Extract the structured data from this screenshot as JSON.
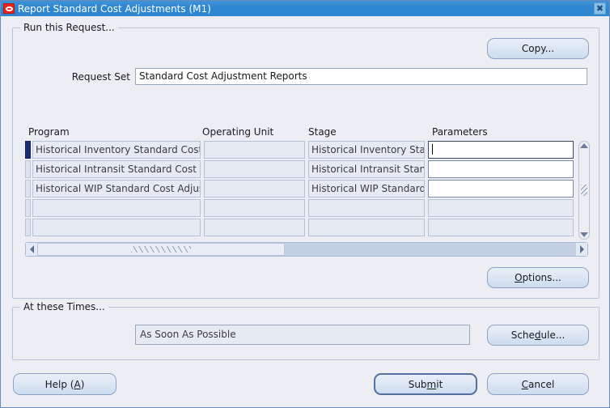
{
  "window": {
    "title": "Report Standard Cost Adjustments (M1)",
    "logo_icon": "oracle-logo-icon",
    "close_icon": "close-icon",
    "title_bar_color": "#2f86d0",
    "background_color": "#eceef4"
  },
  "run_request": {
    "legend": "Run this Request...",
    "copy_label": "Copy...",
    "options_label": "Options...",
    "request_set": {
      "label": "Request Set",
      "value": "Standard Cost Adjustment Reports",
      "placeholder": ""
    },
    "table": {
      "columns": [
        "Program",
        "Operating Unit",
        "Stage",
        "Parameters"
      ],
      "rows": [
        {
          "selected": true,
          "program": "Historical Inventory Standard Cost A",
          "operating_unit": "",
          "stage": "Historical Inventory Stand",
          "parameters": "",
          "parameters_editable": true,
          "parameters_focused": true
        },
        {
          "selected": false,
          "program": "Historical Intransit Standard Cost A",
          "operating_unit": "",
          "stage": "Historical Intransit Standa",
          "parameters": "",
          "parameters_editable": true,
          "parameters_focused": false
        },
        {
          "selected": false,
          "program": "Historical WIP Standard Cost Adjus",
          "operating_unit": "",
          "stage": "Historical WIP Standard C",
          "parameters": "",
          "parameters_editable": true,
          "parameters_focused": false
        },
        {
          "selected": false,
          "program": "",
          "operating_unit": "",
          "stage": "",
          "parameters": "",
          "parameters_editable": false,
          "parameters_focused": false
        },
        {
          "selected": false,
          "program": "",
          "operating_unit": "",
          "stage": "",
          "parameters": "",
          "parameters_editable": false,
          "parameters_focused": false
        }
      ],
      "vscroll_up_icon": "scroll-up-arrow-icon",
      "vscroll_down_icon": "scroll-down-arrow-icon",
      "hscroll_left_icon": "scroll-left-arrow-icon",
      "hscroll_right_icon": "scroll-right-arrow-icon"
    }
  },
  "at_these_times": {
    "legend": "At these Times...",
    "schedule_value": "As Soon As Possible",
    "schedule_label": "Schedule..."
  },
  "footer": {
    "help_label": "Help (A)",
    "submit_label": "Submit",
    "cancel_label": "Cancel"
  }
}
